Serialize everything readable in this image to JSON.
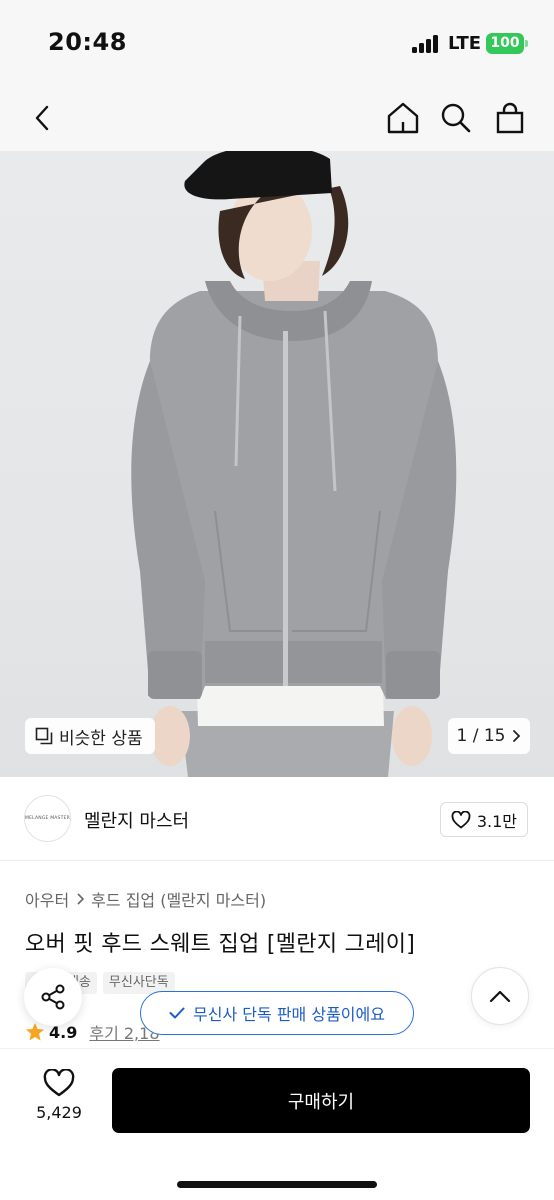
{
  "status_bar": {
    "time": "20:48",
    "network": "LTE",
    "battery": "100"
  },
  "nav": {
    "icons": [
      "chevron-left-icon",
      "home-icon",
      "search-icon",
      "bag-icon"
    ]
  },
  "gallery": {
    "similar_label": "비슷한 상품",
    "counter": "1 / 15"
  },
  "brand": {
    "logo_text": "MELANGE MASTER",
    "name": "멜란지 마스터",
    "likes": "3.1만"
  },
  "product": {
    "breadcrumb": [
      "아우터",
      "후드 집업 (멜란지 마스터)"
    ],
    "title": "오버 핏 후드 스웨트 집업 [멜란지 그레이]",
    "tags": [
      "배송",
      "무신사단독"
    ],
    "rating": "4.9",
    "reviews": "후기 2,18"
  },
  "banner": {
    "exclusive": "무신사 단독 판매 상품이에요"
  },
  "bottom": {
    "wish_count": "5,429",
    "buy_label": "구매하기"
  },
  "colors": {
    "accent_blue": "#1d5cc7",
    "battery_green": "#34c759",
    "star": "#f5a623",
    "buy_button": "#000000"
  }
}
